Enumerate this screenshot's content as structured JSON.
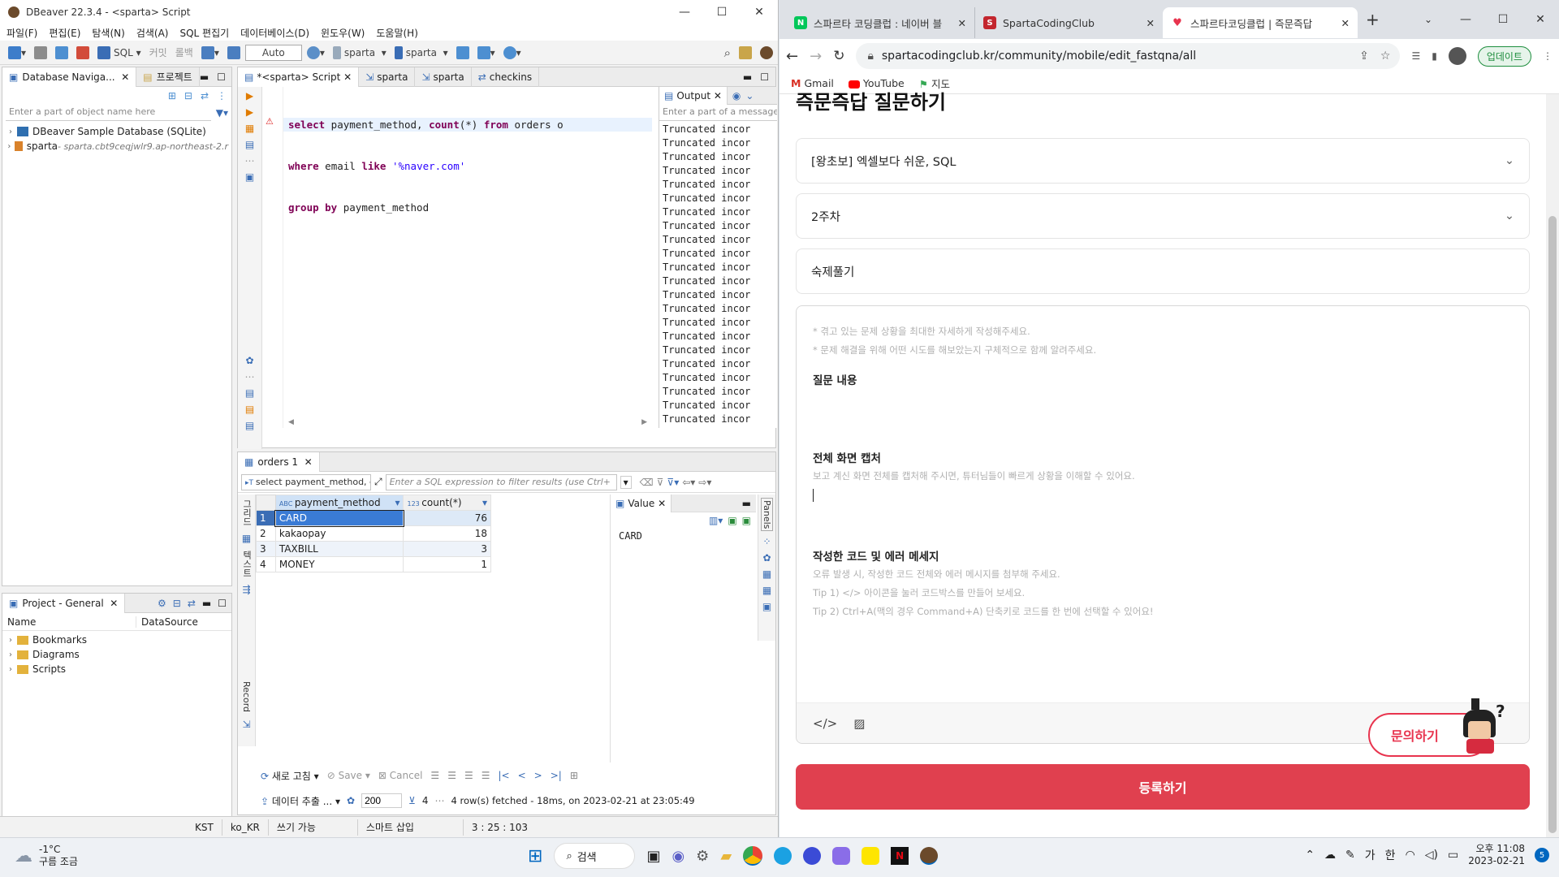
{
  "dbeaver": {
    "title": "DBeaver 22.3.4 - <sparta> Script",
    "menu": [
      "파일(F)",
      "편집(E)",
      "탐색(N)",
      "검색(A)",
      "SQL 편집기",
      "데이터베이스(D)",
      "윈도우(W)",
      "도움말(H)"
    ],
    "toolbar": {
      "sql": "SQL",
      "commit": "커밋",
      "rollback": "롤백",
      "auto": "Auto",
      "ds1": "sparta",
      "ds2": "sparta"
    },
    "nav": {
      "tab_db": "Database Naviga...",
      "tab_project": "프로젝트",
      "filter_placeholder": "Enter a part of object name here",
      "items": [
        {
          "label": "DBeaver Sample Database (SQLite)",
          "sub": ""
        },
        {
          "label": "sparta",
          "sub": " - sparta.cbt9ceqjwlr9.ap-northeast-2.r"
        }
      ]
    },
    "project": {
      "tab": "Project - General",
      "col_name": "Name",
      "col_ds": "DataSource",
      "items": [
        "Bookmarks",
        "Diagrams",
        "Scripts"
      ]
    },
    "editor_tabs": [
      "*<sparta> Script",
      "sparta",
      "sparta",
      "checkins"
    ],
    "sql": {
      "line1": {
        "k1": "select",
        "t1": " payment_method, ",
        "k2": "count",
        "t2": "(*) ",
        "k3": "from",
        "t3": " orders o"
      },
      "line2": {
        "k1": "where",
        "t1": " email ",
        "k2": "like",
        "s1": " '%naver.com'"
      },
      "line3": {
        "k1": "group by",
        "t1": " payment_method"
      }
    },
    "output": {
      "tab": "Output",
      "filter_placeholder": "Enter a part of a message",
      "lines": [
        "Truncated incor",
        "Truncated incor",
        "Truncated incor",
        "Truncated incor",
        "Truncated incor",
        "Truncated incor",
        "Truncated incor",
        "Truncated incor",
        "Truncated incor",
        "Truncated incor",
        "Truncated incor",
        "Truncated incor",
        "Truncated incor",
        "Truncated incor",
        "Truncated incor",
        "Truncated incor",
        "Truncated incor",
        "Truncated incor",
        "Truncated incor",
        "Truncated incor",
        "Truncated incor",
        "Truncated incor"
      ]
    },
    "results": {
      "tab": "orders 1",
      "query_label": "select payment_method, c",
      "filter_placeholder": "Enter a SQL expression to filter results (use Ctrl+",
      "columns": [
        "payment_method",
        "count(*)"
      ],
      "rows": [
        {
          "n": "1",
          "method": "CARD",
          "count": "76"
        },
        {
          "n": "2",
          "method": "kakaopay",
          "count": "18"
        },
        {
          "n": "3",
          "method": "TAXBILL",
          "count": "3"
        },
        {
          "n": "4",
          "method": "MONEY",
          "count": "1"
        }
      ],
      "value_tab": "Value",
      "value_text": "CARD",
      "panels_label": "Panels",
      "side_labels": {
        "grid": "그리드",
        "text": "텍스트",
        "record": "Record"
      },
      "bottom": {
        "refresh": "새로 고침",
        "save": "Save",
        "cancel": "Cancel",
        "export": "데이터 추출 ...",
        "fetch_size": "200",
        "rows_count": "4",
        "status": "4 row(s) fetched - 18ms, on 2023-02-21 at 23:05:49"
      }
    },
    "statusbar": [
      "KST",
      "ko_KR",
      "쓰기 가능",
      "스마트 삽입",
      "3 : 25 : 103"
    ]
  },
  "chrome": {
    "tabs": [
      {
        "title": "스파르타 코딩클럽 : 네이버 블",
        "fav": "N",
        "color": "#03c75a"
      },
      {
        "title": "SpartaCodingClub",
        "fav": "S",
        "color": "#c3262e"
      },
      {
        "title": "스파르타코딩클럽 | 즉문즉답",
        "fav": "♥",
        "color": "#e8344e"
      }
    ],
    "url": "spartacodingclub.kr/community/mobile/edit_fastqna/all",
    "update_label": "업데이트",
    "bookmarks": [
      "Gmail",
      "YouTube",
      "지도"
    ],
    "page": {
      "heading": "즉문즉답 질문하기",
      "course": "[왕초보] 엑셀보다 쉬운, SQL",
      "week": "2주차",
      "category": "숙제풀기",
      "hint1": "* 겪고 있는 문제 상황을 최대한 자세하게 작성해주세요.",
      "hint2": "* 문제 해결을 위해 어떤 시도를 해보았는지 구체적으로 함께 알려주세요.",
      "sec_question": "질문 내용",
      "sec_capture": "전체 화면 캡처",
      "capture_hint": "보고 계신 화면 전체를 캡처해 주시면, 튜터님들이 빠르게 상황을 이해할 수 있어요.",
      "sec_code": "작성한 코드 및 에러 메세지",
      "code_hint1": "오류 발생 시, 작성한 코드 전체와 에러 메시지를 첨부해 주세요.",
      "code_hint2": "Tip 1) </> 아이콘을 눌러 코드박스를 만들어 보세요.",
      "code_hint3": "Tip 2) Ctrl+A(맥의 경우 Command+A) 단축키로 코드를 한 번에 선택할 수 있어요!",
      "inquiry": "문의하기",
      "submit": "등록하기"
    }
  },
  "taskbar": {
    "weather_temp": "-1°C",
    "weather_desc": "구름 조금",
    "search": "검색",
    "ime1": "가",
    "ime2": "한",
    "time": "오후 11:08",
    "date": "2023-02-21",
    "notif": "5"
  }
}
